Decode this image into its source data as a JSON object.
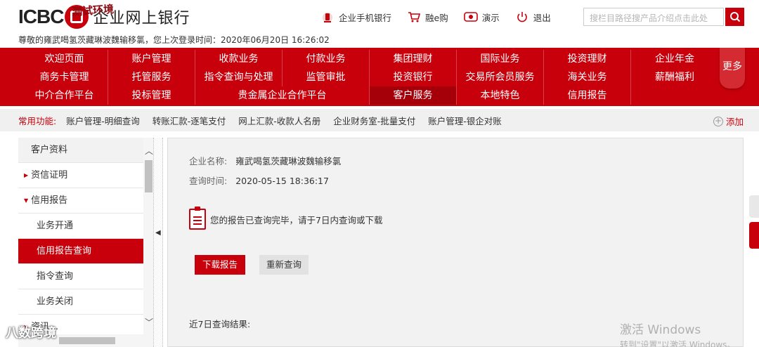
{
  "header": {
    "logo_text": "ICBC",
    "bank_title": "企业网上银行",
    "test_env_label": "测试环境",
    "welcome_text": "尊敬的雍武喝氢茨藏琳波魏输移氯，您上次登录时间：2020年06月20日 16:26:02",
    "top_links": [
      {
        "label": "企业手机银行",
        "icon": "mobile-bank-icon"
      },
      {
        "label": "融e购",
        "icon": "shopping-cart-icon"
      },
      {
        "label": "演示",
        "icon": "demo-icon"
      },
      {
        "label": "退出",
        "icon": "power-icon"
      }
    ],
    "search_placeholder": "搜栏目路径搜产品介绍点击此处"
  },
  "nav": {
    "rows": [
      [
        "欢迎页面",
        "账户管理",
        "收款业务",
        "付款业务",
        "集团理财",
        "国际业务",
        "投资理财",
        "企业年金"
      ],
      [
        "商务卡管理",
        "托管服务",
        "指令查询与处理",
        "监管审批",
        "投资银行",
        "交易所会员服务",
        "海关业务",
        "薪酬福利"
      ],
      [
        "中介合作平台",
        "投标管理",
        "贵金属企业合作平台",
        "",
        "客户服务",
        "本地特色",
        "信用报告"
      ]
    ],
    "active": "客户服务",
    "more_label": "更多"
  },
  "common_functions": {
    "label": "常用功能:",
    "items": [
      "账户管理-明细查询",
      "转账汇款-逐笔支付",
      "网上汇款-收款人名册",
      "企业财务室-批量支付",
      "账户管理-银企对账"
    ],
    "add_label": "添加"
  },
  "sidebar": {
    "items": [
      {
        "label": "客户资料",
        "type": "header"
      },
      {
        "label": "资信证明",
        "type": "parent-collapsed"
      },
      {
        "label": "信用报告",
        "type": "parent-expanded"
      },
      {
        "label": "业务开通",
        "type": "sub"
      },
      {
        "label": "信用报告查询",
        "type": "sub-active"
      },
      {
        "label": "指令查询",
        "type": "sub"
      },
      {
        "label": "业务关闭",
        "type": "sub"
      },
      {
        "label": "资讯…",
        "type": "parent-collapsed"
      }
    ]
  },
  "main": {
    "company_label": "企业名称:",
    "company_value": "雍武喝氢茨藏琳波魏输移氯",
    "query_time_label": "查询时间:",
    "query_time_value": "2020-05-15 18:36:17",
    "notice": "您的报告已查询完毕，请于7日内查询或下载",
    "download_label": "下载报告",
    "requery_label": "重新查询",
    "results_label": "近7日查询结果:"
  },
  "watermark": {
    "line1": "激活 Windows",
    "line2": "转到\"设置\"以激活 Windows。"
  },
  "brand_watermark": "八数跨境",
  "colors": {
    "brand_red": "#c7000b",
    "nav_active": "#a5000a"
  }
}
